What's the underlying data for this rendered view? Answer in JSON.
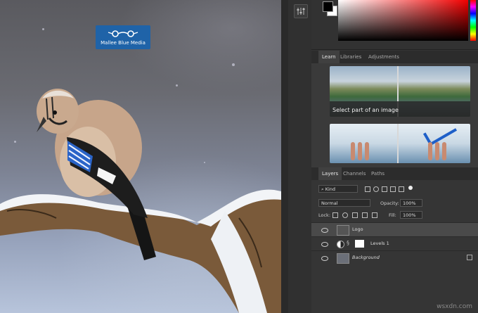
{
  "canvas": {
    "logo_text": "Mallee Blue Media"
  },
  "learn_tabs": [
    {
      "label": "Learn",
      "active": true
    },
    {
      "label": "Libraries",
      "active": false
    },
    {
      "label": "Adjustments",
      "active": false
    }
  ],
  "learn": {
    "card1_title": "Select part of an image"
  },
  "layer_tabs": [
    {
      "label": "Layers",
      "active": true
    },
    {
      "label": "Channels",
      "active": false
    },
    {
      "label": "Paths",
      "active": false
    }
  ],
  "layers_panel": {
    "filter_label": "Kind",
    "blend_mode": "Normal",
    "opacity_label": "Opacity:",
    "opacity_value": "100%",
    "lock_label": "Lock:",
    "fill_label": "Fill:",
    "fill_value": "100%"
  },
  "layers": [
    {
      "name": "Logo",
      "selected": true
    },
    {
      "name": "Levels 1",
      "selected": false
    },
    {
      "name": "Background",
      "selected": false,
      "italic": true
    }
  ],
  "watermark": "wsxdn.com",
  "colors": {
    "logo_bg": "#1f63a8",
    "panel_bg": "#353535",
    "selected_layer": "#4a4a4a"
  }
}
